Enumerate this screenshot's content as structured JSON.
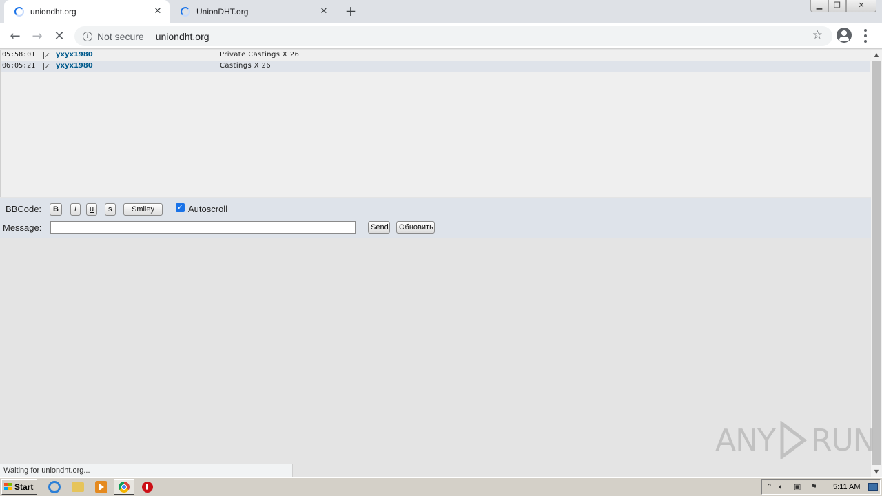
{
  "browser": {
    "tabs": [
      {
        "title": "uniondht.org",
        "active": true
      },
      {
        "title": "UnionDHT.org",
        "active": false
      }
    ],
    "omnibox": {
      "security_label": "Not secure",
      "url": "uniondht.org"
    },
    "status_text": "Waiting for uniondht.org..."
  },
  "chat": {
    "messages": [
      {
        "time": "05:58:01",
        "user": "yxyx1980",
        "text": "Private Castings X 26"
      },
      {
        "time": "06:05:21",
        "user": "yxyx1980",
        "text": "Castings X 26"
      }
    ]
  },
  "form": {
    "bbcode_label": "BBCode:",
    "bbcode_buttons": [
      "B",
      "i",
      "u",
      "s",
      "Smiley"
    ],
    "autoscroll_label": "Autoscroll",
    "autoscroll_checked": true,
    "message_label": "Message:",
    "message_value": "",
    "send_label": "Send",
    "refresh_label": "Обновить"
  },
  "watermark": {
    "left": "ANY",
    "right": "RUN"
  },
  "taskbar": {
    "start_label": "Start",
    "clock": "5:11 AM"
  },
  "colors": {
    "accent": "#1a73e8",
    "username": "#005a8c",
    "form_bg": "#dee3ea"
  }
}
